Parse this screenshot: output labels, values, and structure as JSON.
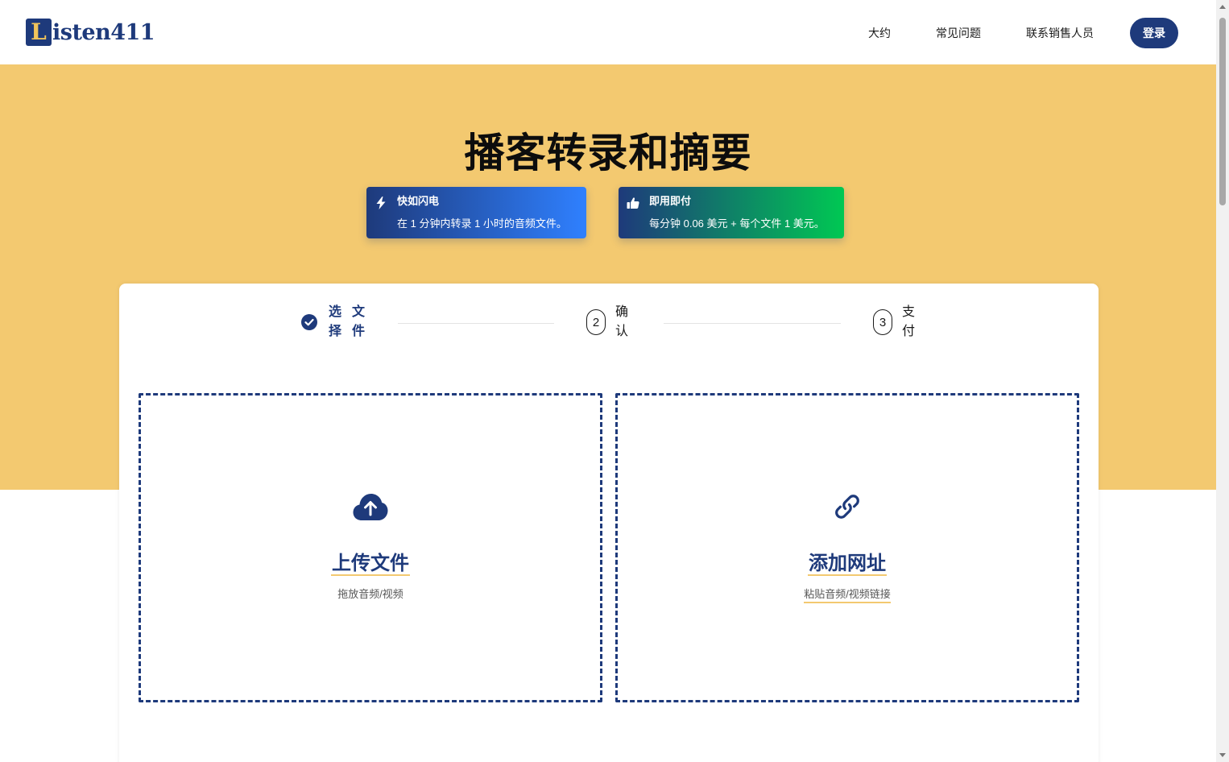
{
  "header": {
    "logo_letter": "L",
    "logo_text": "isten411",
    "nav": [
      "大约",
      "常见问题",
      "联系销售人员"
    ],
    "login_label": "登录"
  },
  "hero": {
    "title": "播客转录和摘要",
    "features": [
      {
        "icon": "lightning-icon",
        "title": "快如闪电",
        "desc": "在 1 分钟内转录 1 小时的音频文件。"
      },
      {
        "icon": "thumbs-up-icon",
        "title": "即用即付",
        "desc": "每分钟 0.06 美元 + 每个文件 1 美元。"
      }
    ]
  },
  "steps": [
    {
      "status": "done",
      "label_chars": [
        "选",
        "文",
        "择",
        "件"
      ]
    },
    {
      "number": "2",
      "label_chars": [
        "确",
        "认"
      ]
    },
    {
      "number": "3",
      "label_chars": [
        "支",
        "付"
      ]
    }
  ],
  "upload_options": [
    {
      "icon": "cloud-upload-icon",
      "title": "上传文件",
      "subtitle": "拖放音频/视频"
    },
    {
      "icon": "link-icon",
      "title": "添加网址",
      "subtitle": "粘贴音频/视频链接"
    }
  ],
  "colors": {
    "brand_navy": "#1e3a7b",
    "hero_yellow": "#f3c970",
    "feature1_gradient_end": "#2f80ff",
    "feature2_gradient_end": "#00c853"
  }
}
